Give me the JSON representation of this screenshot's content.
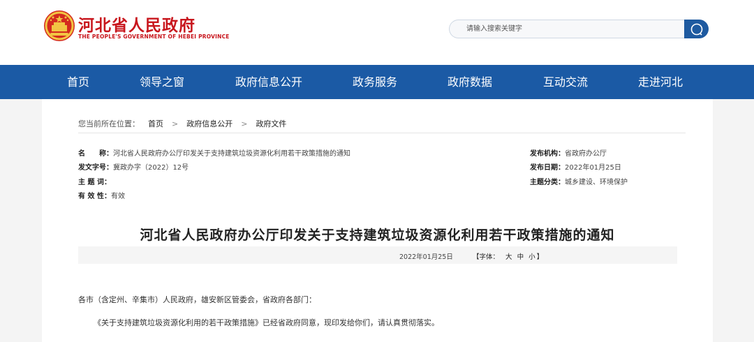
{
  "header": {
    "title": "河北省人民政府",
    "subtitle": "THE PEOPLE'S GOVERNMENT OF HEBEI PROVINCE",
    "search_placeholder": "请输入搜索关键字",
    "brand_color": "#c8161d"
  },
  "nav": {
    "items": [
      "首页",
      "领导之窗",
      "政府信息公开",
      "政务服务",
      "政府数据",
      "互动交流",
      "走进河北"
    ],
    "bg_color": "#1b5aa5"
  },
  "breadcrumb": {
    "prefix": "您当前所在位置：",
    "items": [
      "首页",
      "政府信息公开",
      "政府文件"
    ]
  },
  "meta": {
    "name_label": "名　　称：",
    "name_value": "河北省人民政府办公厅印发关于支持建筑垃圾资源化利用若干政策措施的通知",
    "doc_no_label": "发文字号：",
    "doc_no_value": "冀政办字（2022）12号",
    "subject_label": "主 题 词：",
    "subject_value": "",
    "validity_label": "有 效 性：",
    "validity_value": "有效",
    "issuer_label": "发布机构：",
    "issuer_value": "省政府办公厅",
    "date_label": "发布日期：",
    "date_value": "2022年01月25日",
    "category_label": "主题分类：",
    "category_value": "城乡建设、环境保护"
  },
  "document": {
    "title": "河北省人民政府办公厅印发关于支持建筑垃圾资源化利用若干政策措施的通知",
    "date": "2022年01月25日",
    "font_label": "【字体：",
    "font_large": "大",
    "font_medium": "中",
    "font_small": "小",
    "font_close": "】",
    "salutation": "各市（含定州、辛集市）人民政府，雄安新区管委会，省政府各部门：",
    "body_1": "《关于支持建筑垃圾资源化利用的若干政策措施》已经省政府同意，现印发给你们，请认真贯彻落实。"
  }
}
